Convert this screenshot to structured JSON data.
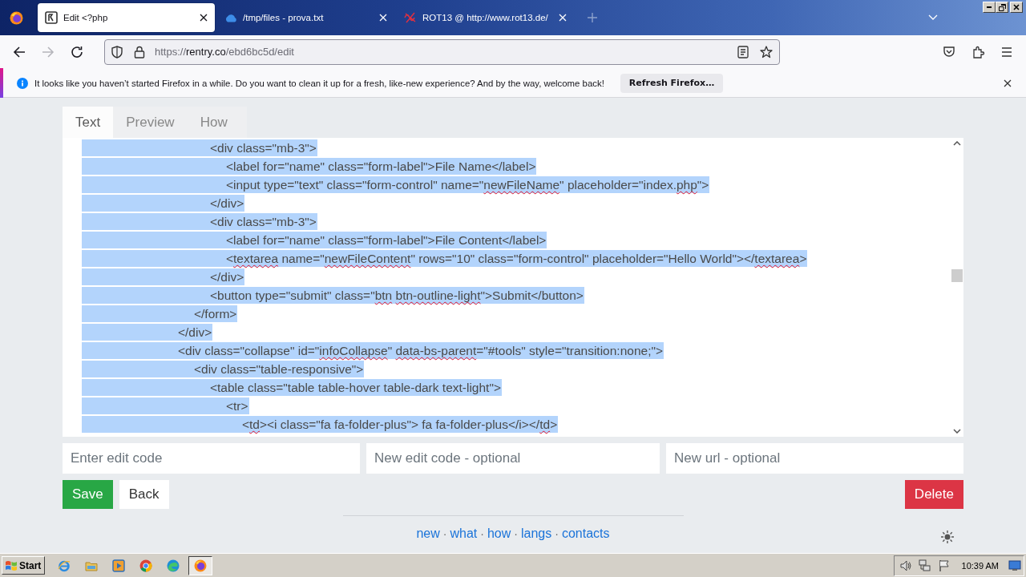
{
  "browser": {
    "tabs": [
      {
        "title": "Edit <?php",
        "kind": "page",
        "selected": true
      },
      {
        "title": "/tmp/files - prova.txt",
        "kind": "cloud",
        "selected": false
      },
      {
        "title": "ROT13 @ http://www.rot13.de/",
        "kind": "scribble",
        "selected": false
      }
    ],
    "nav_buttons": [
      {
        "kind": "back",
        "disabled": false
      },
      {
        "kind": "forward",
        "disabled": true
      },
      {
        "kind": "reload",
        "disabled": false
      }
    ],
    "address": {
      "scheme": "https://",
      "domain": "rentry.co",
      "path": "/ebd6bc5d/edit"
    },
    "notification": {
      "message": "It looks like you haven’t started Firefox in a while. Do you want to clean it up for a fresh, like-new experience? And by the way, welcome back!",
      "button": "Refresh Firefox…"
    }
  },
  "editor": {
    "tabs": [
      {
        "label": "Text",
        "selected": true
      },
      {
        "label": "Preview",
        "selected": false
      },
      {
        "label": "How",
        "selected": false
      }
    ],
    "text_selected": true,
    "lines": [
      {
        "segments": [
          {
            "text": "\t\t\t\t\t\t\t\t<div class=\"mb-3\">",
            "misspelled": false
          }
        ]
      },
      {
        "segments": [
          {
            "text": "\t\t\t\t\t\t\t\t\t<label for=\"name\" class=\"form-label\">File Name</label>",
            "misspelled": false
          }
        ]
      },
      {
        "segments": [
          {
            "text": "\t\t\t\t\t\t\t\t\t<input type=\"text\" class=\"form-control\" name=\"",
            "misspelled": false
          },
          {
            "text": "newFileName",
            "misspelled": true
          },
          {
            "text": "\" placeholder=\"index.",
            "misspelled": false
          },
          {
            "text": "php",
            "misspelled": true
          },
          {
            "text": "\">",
            "misspelled": false
          }
        ]
      },
      {
        "segments": [
          {
            "text": "\t\t\t\t\t\t\t\t</div>",
            "misspelled": false
          }
        ]
      },
      {
        "segments": [
          {
            "text": "\t\t\t\t\t\t\t\t<div class=\"mb-3\">",
            "misspelled": false
          }
        ]
      },
      {
        "segments": [
          {
            "text": "\t\t\t\t\t\t\t\t\t<label for=\"name\" class=\"form-label\">File Content</label>",
            "misspelled": false
          }
        ]
      },
      {
        "segments": [
          {
            "text": "\t\t\t\t\t\t\t\t\t<",
            "misspelled": false
          },
          {
            "text": "textarea",
            "misspelled": true
          },
          {
            "text": " name=\"",
            "misspelled": false
          },
          {
            "text": "newFileContent",
            "misspelled": true
          },
          {
            "text": "\" rows=\"10\" class=\"form-control\" placeholder=\"Hello World\"></",
            "misspelled": false
          },
          {
            "text": "textarea",
            "misspelled": true
          },
          {
            "text": ">",
            "misspelled": false
          }
        ]
      },
      {
        "segments": [
          {
            "text": "\t\t\t\t\t\t\t\t</div>",
            "misspelled": false
          }
        ]
      },
      {
        "segments": [
          {
            "text": "\t\t\t\t\t\t\t\t<button type=\"submit\" class=\"",
            "misspelled": false
          },
          {
            "text": "btn",
            "misspelled": true
          },
          {
            "text": " btn-outline-light",
            "misspelled": true
          },
          {
            "text": "\">Submit</button>",
            "misspelled": false
          }
        ]
      },
      {
        "segments": [
          {
            "text": "\t\t\t\t\t\t\t</form>",
            "misspelled": false
          }
        ]
      },
      {
        "segments": [
          {
            "text": "\t\t\t\t\t\t</div>",
            "misspelled": false
          }
        ]
      },
      {
        "segments": [
          {
            "text": "\t\t\t\t\t\t<div class=\"collapse\" id=\"",
            "misspelled": false
          },
          {
            "text": "infoCollapse",
            "misspelled": true
          },
          {
            "text": "\" ",
            "misspelled": false
          },
          {
            "text": "data-bs-parent",
            "misspelled": true
          },
          {
            "text": "=\"#tools\" style=\"transition:none;\">",
            "misspelled": false
          }
        ]
      },
      {
        "segments": [
          {
            "text": "\t\t\t\t\t\t\t<div class=\"table-responsive\">",
            "misspelled": false
          }
        ]
      },
      {
        "segments": [
          {
            "text": "\t\t\t\t\t\t\t\t<table class=\"table table-hover table-dark text-light\">",
            "misspelled": false
          }
        ]
      },
      {
        "segments": [
          {
            "text": "\t\t\t\t\t\t\t\t\t<tr>",
            "misspelled": false
          }
        ]
      },
      {
        "segments": [
          {
            "text": "\t\t\t\t\t\t\t\t\t\t<",
            "misspelled": false
          },
          {
            "text": "td",
            "misspelled": true
          },
          {
            "text": "><i class=\"fa fa-folder-plus\"> fa fa-folder-plus</i></",
            "misspelled": false
          },
          {
            "text": "td",
            "misspelled": true
          },
          {
            "text": ">",
            "misspelled": false
          }
        ]
      }
    ]
  },
  "form": {
    "fields": [
      {
        "placeholder": "Enter edit code"
      },
      {
        "placeholder": "New edit code - optional"
      },
      {
        "placeholder": "New url - optional"
      }
    ],
    "buttons": [
      {
        "label": "Save",
        "kind": "save"
      },
      {
        "label": "Back",
        "kind": "back"
      },
      {
        "label": "Delete",
        "kind": "delete"
      }
    ]
  },
  "footer": {
    "items": [
      {
        "kind": "link",
        "text": "new"
      },
      {
        "kind": "separator",
        "text": "·"
      },
      {
        "kind": "link",
        "text": "what"
      },
      {
        "kind": "separator",
        "text": "·"
      },
      {
        "kind": "link",
        "text": "how"
      },
      {
        "kind": "separator",
        "text": "·"
      },
      {
        "kind": "link",
        "text": "langs"
      },
      {
        "kind": "separator",
        "text": "·"
      },
      {
        "kind": "link",
        "text": "contacts"
      }
    ]
  },
  "taskbar": {
    "start": "Start",
    "apps": [
      {
        "kind": "e",
        "selected": false
      },
      {
        "kind": "folder",
        "selected": false
      },
      {
        "kind": "player",
        "selected": false
      },
      {
        "kind": "ball",
        "selected": false
      },
      {
        "kind": "wave",
        "selected": false
      },
      {
        "kind": "fox",
        "selected": true
      }
    ],
    "clock": "10:39 AM"
  }
}
